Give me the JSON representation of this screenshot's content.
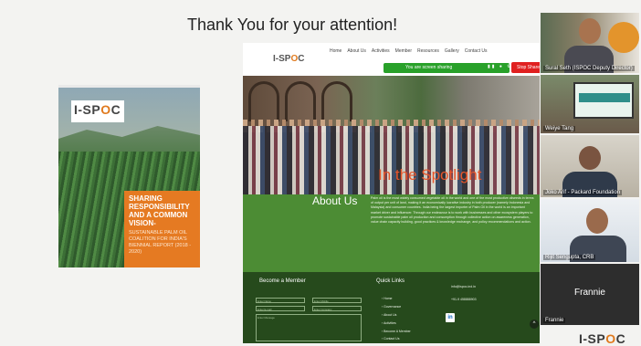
{
  "slide": {
    "title": "Thank You for your attention!"
  },
  "report_cover": {
    "logo_prefix": "I-SP",
    "logo_accent": "O",
    "logo_suffix": "C",
    "heading": "SHARING RESPONSIBILITY AND A COMMON VISION-",
    "subheading": "SUSTAINABLE PALM OIL COALITION FOR INDIA'S BIENNIAL REPORT (2018 - 2020)"
  },
  "website": {
    "nav": [
      "Home",
      "About Us",
      "Activities",
      "Member",
      "Resources",
      "Gallery",
      "Contact Us"
    ],
    "brand_prefix": "I-SP",
    "brand_accent": "O",
    "brand_suffix": "C",
    "share_bar_text": "You are screen sharing",
    "stop_share_label": "Stop Share",
    "spotlight_heading": "In the Spotlight",
    "about_heading": "About Us",
    "about_text": "Palm oil is the most widely consumed vegetable oil in the world and one of the most productive oilseeds in terms of output per unit of land, making it an economically lucrative industry in both producer (namely Indonesia and Malaysia) and consumer countries. India being the largest importer of Palm Oil in the world is an important market driver and influencer. Through our endeavour is to work with businesses and other ecosystem players to promote sustainable palm oil production and consumption through collective action on awareness generation, value chain capacity building, good practices & knowledge exchange, and policy recommendations and action.",
    "footer": {
      "member_heading": "Become a Member",
      "fields": {
        "name": "Enter Name",
        "mobile": "Enter Mobile",
        "mail": "Enter E-mail",
        "company": "Enter Company",
        "message": "Enter Message"
      },
      "quick_links_heading": "Quick Links",
      "quick_links": [
        "Home",
        "Governance",
        "About Us",
        "Activities",
        "Become A Member",
        "Contact Us"
      ],
      "email": "info@ispoc-ind.in",
      "phone": "+91-9 458888903"
    }
  },
  "participants": [
    {
      "name": "Sural Seth (ISPOC Deputy Director)"
    },
    {
      "name": "Weiye Tang"
    },
    {
      "name": "Joko Arif - Packard Foundation"
    },
    {
      "name": "Rijit Sengupta, CRB"
    },
    {
      "name": "Frannie",
      "display": "Frannie"
    }
  ],
  "bottom_logo": {
    "prefix": "I-SP",
    "accent": "O",
    "suffix": "C"
  }
}
